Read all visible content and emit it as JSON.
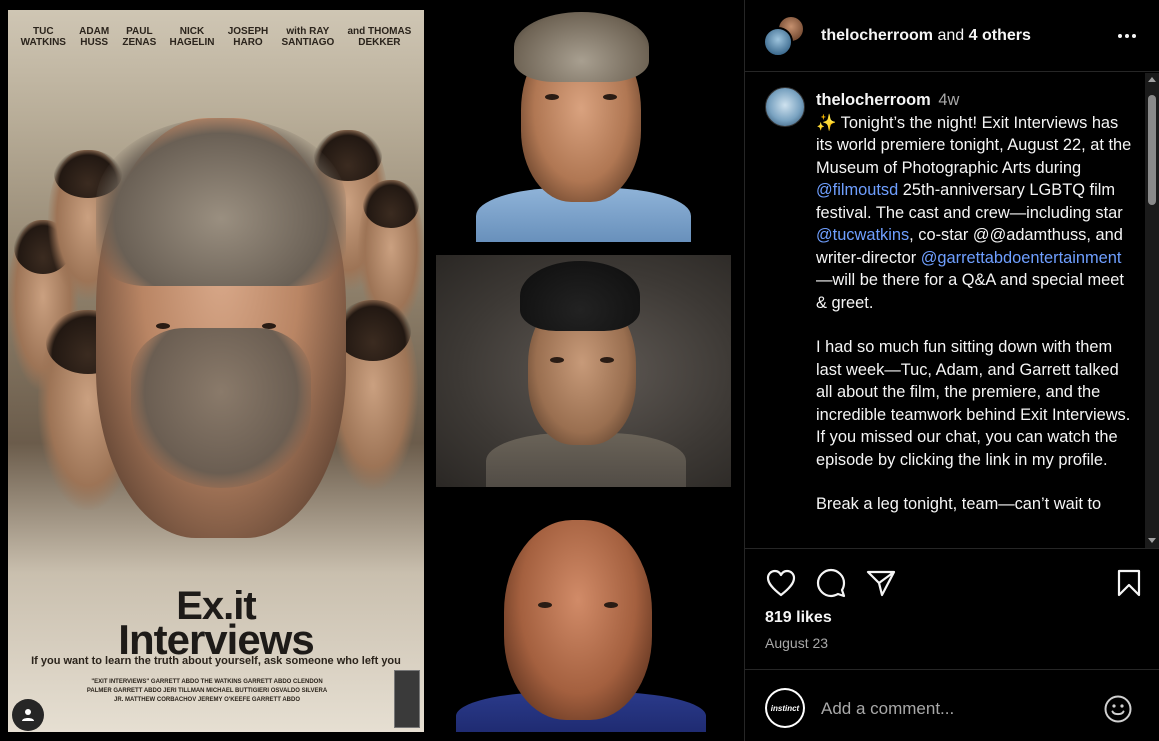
{
  "poster": {
    "credits": [
      {
        "line1": "TUC",
        "line2": "WATKINS"
      },
      {
        "line1": "ADAM",
        "line2": "HUSS"
      },
      {
        "line1": "PAUL",
        "line2": "ZENAS"
      },
      {
        "line1": "NICK",
        "line2": "HAGELIN"
      },
      {
        "line1": "JOSEPH",
        "line2": "HARO"
      },
      {
        "line1": "with RAY",
        "line2": "SANTIAGO"
      },
      {
        "line1": "and THOMAS",
        "line2": "DEKKER"
      }
    ],
    "title_line1": "Ex.it",
    "title_line2": "Interviews",
    "tagline": "If you want to learn the truth about yourself, ask someone who left you",
    "billing": "\"EXIT INTERVIEWS\" GARRETT ABDO THE WATKINS GARRETT ABDO CLENDON PALMER GARRETT ABDO JERI TILLMAN MICHAEL BUTTIGIERI OSVALDO SILVERA JR. MATTHEW CORBACHOV JEREMY O'KEEFE GARRETT ABDO"
  },
  "header": {
    "username": "thelocherroom",
    "and_text": "and",
    "others": "4 others"
  },
  "caption": {
    "username": "thelocherroom",
    "time": "4w",
    "p1_a": "✨ Tonight’s the night! Exit Interviews has its world premiere tonight, August 22, at the Museum of Photographic Arts during ",
    "mention_filmoutsd": "@filmoutsd",
    "p1_b": "  25th-anniversary LGBTQ film festival. The cast and crew—including star ",
    "mention_tucwatkins": "@tucwatkins",
    "p1_c": ", co-star @@adamthuss, and writer-director ",
    "mention_garrett": "@garrettabdoentertainment",
    "p1_d": "—will be there for a Q&A and special meet & greet.",
    "p2": "I had so much fun sitting down with them last week—Tuc, Adam, and Garrett talked all about the film, the premiere, and the incredible teamwork behind Exit Interviews. If you missed our chat, you can watch the episode by clicking the link in my profile.",
    "p3": "Break a leg tonight, team—can’t wait to"
  },
  "likes": "819 likes",
  "date": "August 23",
  "comment": {
    "avatar_text": "instinct",
    "placeholder": "Add a comment..."
  },
  "colors": {
    "background": "#000000",
    "link": "#6f9fff",
    "muted": "#a8a8a8",
    "border": "#262626"
  }
}
